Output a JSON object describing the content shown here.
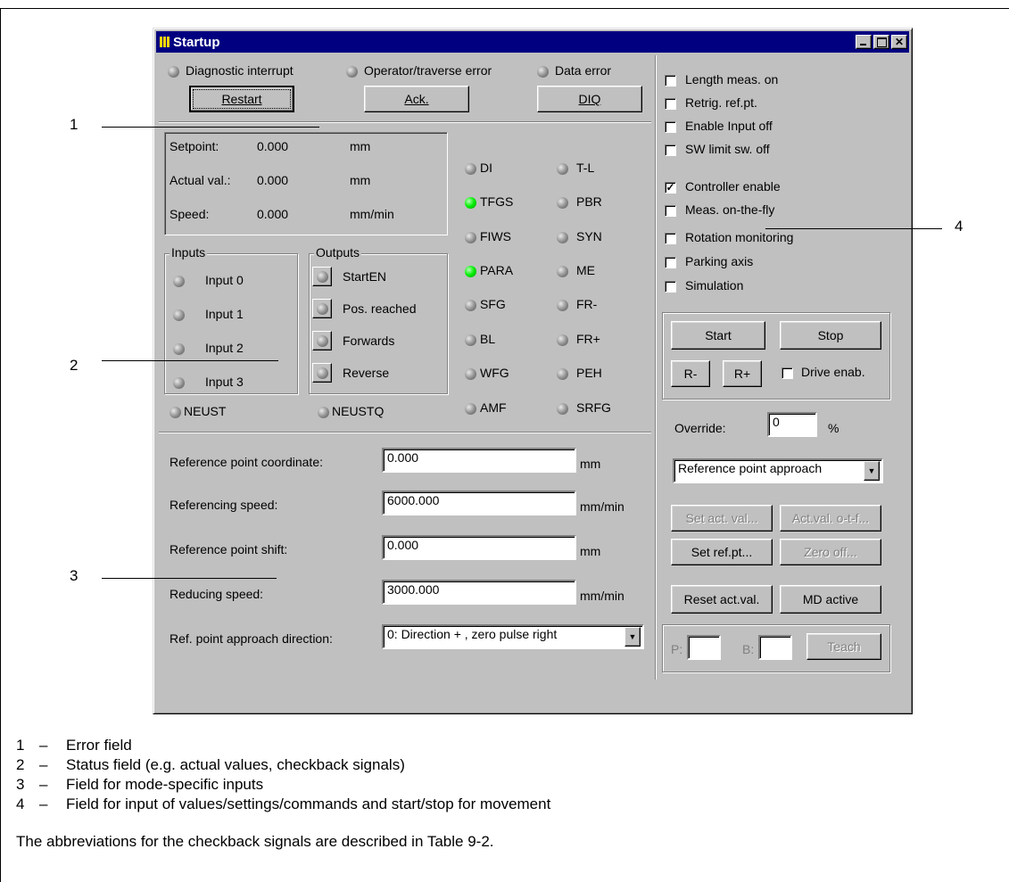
{
  "window": {
    "title": "Startup"
  },
  "error_field": {
    "indicators": [
      "Diagnostic interrupt",
      "Operator/traverse error",
      "Data error"
    ],
    "buttons": [
      "Restart",
      "Ack.",
      "DIQ"
    ]
  },
  "values": [
    {
      "label": "Setpoint:",
      "value": "0.000",
      "unit": "mm"
    },
    {
      "label": "Actual val.:",
      "value": "0.000",
      "unit": "mm"
    },
    {
      "label": "Speed:",
      "value": "0.000",
      "unit": "mm/min"
    }
  ],
  "inputs": {
    "title": "Inputs",
    "items": [
      "Input 0",
      "Input 1",
      "Input 2",
      "Input 3"
    ]
  },
  "outputs": {
    "title": "Outputs",
    "items": [
      "StartEN",
      "Pos. reached",
      "Forwards",
      "Reverse"
    ]
  },
  "signals_left": [
    {
      "name": "DI",
      "on": false
    },
    {
      "name": "TFGS",
      "on": true
    },
    {
      "name": "FIWS",
      "on": false
    },
    {
      "name": "PARA",
      "on": true
    },
    {
      "name": "SFG",
      "on": false
    },
    {
      "name": "BL",
      "on": false
    },
    {
      "name": "WFG",
      "on": false
    },
    {
      "name": "AMF",
      "on": false
    }
  ],
  "signals_right": [
    "T-L",
    "PBR",
    "SYN",
    "ME",
    "FR-",
    "FR+",
    "PEH",
    "SRFG"
  ],
  "neust": [
    "NEUST",
    "NEUSTQ"
  ],
  "mode_inputs": [
    {
      "label": "Reference point coordinate:",
      "value": "0.000",
      "unit": "mm"
    },
    {
      "label": "Referencing speed:",
      "value": "6000.000",
      "unit": "mm/min"
    },
    {
      "label": "Reference point shift:",
      "value": "0.000",
      "unit": "mm"
    },
    {
      "label": "Reducing speed:",
      "value": "3000.000",
      "unit": "mm/min"
    }
  ],
  "direction": {
    "label": "Ref. point approach direction:",
    "value": "0: Direction + , zero pulse right"
  },
  "checkboxes_top": [
    {
      "label": "Length meas. on",
      "checked": false
    },
    {
      "label": "Retrig. ref.pt.",
      "checked": false
    },
    {
      "label": "Enable Input off",
      "checked": false
    },
    {
      "label": "SW limit sw. off",
      "checked": false
    }
  ],
  "checkboxes_bottom": [
    {
      "label": "Controller enable",
      "checked": true
    },
    {
      "label": "Meas. on-the-fly",
      "checked": false
    },
    {
      "label": "Rotation monitoring",
      "checked": false
    },
    {
      "label": "Parking axis",
      "checked": false
    },
    {
      "label": "Simulation",
      "checked": false
    }
  ],
  "control": {
    "start": "Start",
    "stop": "Stop",
    "r_minus": "R-",
    "r_plus": "R+",
    "drive_enab": "Drive enab.",
    "override_label": "Override:",
    "override_value": "0",
    "override_unit": "%",
    "mode_select": "Reference point approach",
    "set_act_val": "Set act. val...",
    "act_val_otf": "Act.val. o-t-f...",
    "set_ref_pt": "Set ref.pt...",
    "zero_off": "Zero off...",
    "reset_act_val": "Reset act.val.",
    "md_active": "MD active",
    "p_label": "P:",
    "b_label": "B:",
    "teach": "Teach"
  },
  "callouts": [
    "1",
    "2",
    "3",
    "4"
  ],
  "legend": [
    {
      "num": "1",
      "dash": "–",
      "text": "Error field"
    },
    {
      "num": "2",
      "dash": "–",
      "text": "Status field (e.g. actual values, checkback signals)"
    },
    {
      "num": "3",
      "dash": "–",
      "text": "Field for mode-specific inputs"
    },
    {
      "num": "4",
      "dash": "–",
      "text": "Field for input of values/settings/commands and start/stop for movement"
    }
  ],
  "footnote": "The abbreviations for the checkback signals are described in Table 9-2."
}
